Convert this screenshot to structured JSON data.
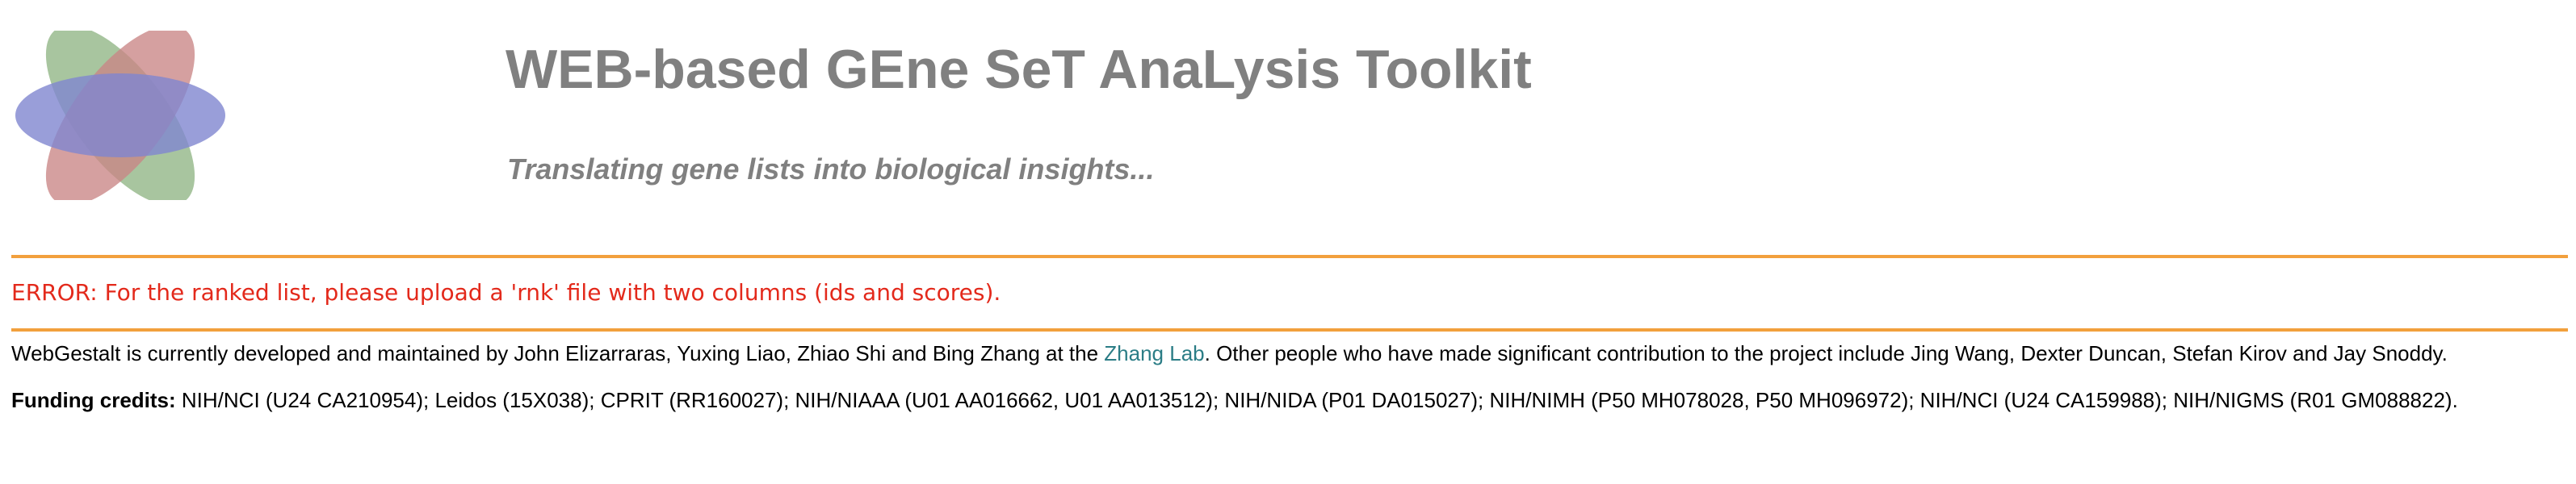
{
  "header": {
    "title": "WEB-based GEne SeT AnaLysis Toolkit",
    "subtitle": "Translating gene lists into biological insights..."
  },
  "logo": {
    "icon": "webgestalt-logo-icon",
    "colors": {
      "green": "#8fb584",
      "red": "#c98585",
      "blue": "#7f86cf",
      "overlap": "#3f6b6b"
    }
  },
  "message": {
    "error": "ERROR: For the ranked list, please upload a 'rnk' file with two columns (ids and scores)."
  },
  "footer": {
    "credits_before": "WebGestalt is currently developed and maintained by John Elizarraras, Yuxing Liao, Zhiao Shi and Bing Zhang at the ",
    "credits_link": "Zhang Lab",
    "credits_after": ". Other people who have made significant contribution to the project include Jing Wang, Dexter Duncan, Stefan Kirov and Jay Snoddy.",
    "funding_label": "Funding credits:",
    "funding_text": " NIH/NCI (U24 CA210954); Leidos (15X038); CPRIT (RR160027); NIH/NIAAA (U01 AA016662, U01 AA013512); NIH/NIDA (P01 DA015027); NIH/NIMH (P50 MH078028, P50 MH096972); NIH/NCI (U24 CA159988); NIH/NIGMS (R01 GM088822)."
  },
  "colors": {
    "title": "#808080",
    "rule": "#f2a03d",
    "error": "#e3291b",
    "link": "#2b7d86"
  }
}
